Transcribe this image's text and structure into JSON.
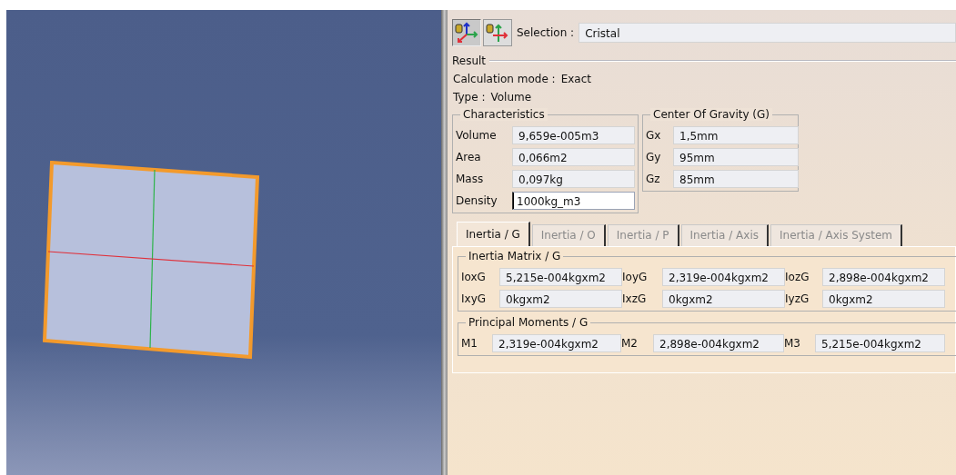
{
  "selection": {
    "label": "Selection :",
    "value": "Cristal"
  },
  "result": {
    "title": "Result",
    "lines": [
      {
        "label": "Calculation mode :",
        "value": "Exact"
      },
      {
        "label": "Type :",
        "value": "Volume"
      }
    ]
  },
  "characteristics": {
    "title": "Characteristics",
    "rows": [
      {
        "label": "Volume",
        "value": "9,659e-005m3",
        "kind": "output"
      },
      {
        "label": "Area",
        "value": "0,066m2",
        "kind": "output"
      },
      {
        "label": "Mass",
        "value": "0,097kg",
        "kind": "output"
      },
      {
        "label": "Density",
        "value": "1000kg_m3",
        "kind": "input"
      }
    ]
  },
  "center_of_gravity": {
    "title": "Center Of Gravity (G)",
    "rows": [
      {
        "label": "Gx",
        "value": "1,5mm"
      },
      {
        "label": "Gy",
        "value": "95mm"
      },
      {
        "label": "Gz",
        "value": "85mm"
      }
    ]
  },
  "tabs": [
    {
      "label": "Inertia / G",
      "selected": true
    },
    {
      "label": "Inertia / O",
      "selected": false
    },
    {
      "label": "Inertia / P",
      "selected": false
    },
    {
      "label": "Inertia / Axis",
      "selected": false
    },
    {
      "label": "Inertia / Axis System",
      "selected": false
    }
  ],
  "inertia_matrix": {
    "title": "Inertia Matrix / G",
    "fields": [
      {
        "label": "IoxG",
        "value": "5,215e-004kgxm2"
      },
      {
        "label": "IoyG",
        "value": "2,319e-004kgxm2"
      },
      {
        "label": "IozG",
        "value": "2,898e-004kgxm2"
      },
      {
        "label": "IxyG",
        "value": "0kgxm2"
      },
      {
        "label": "IxzG",
        "value": "0kgxm2"
      },
      {
        "label": "IyzG",
        "value": "0kgxm2"
      }
    ]
  },
  "principal_moments": {
    "title": "Principal Moments / G",
    "fields": [
      {
        "label": "M1",
        "value": "2,319e-004kgxm2"
      },
      {
        "label": "M2",
        "value": "2,898e-004kgxm2"
      },
      {
        "label": "M3",
        "value": "5,215e-004kgxm2"
      }
    ]
  }
}
